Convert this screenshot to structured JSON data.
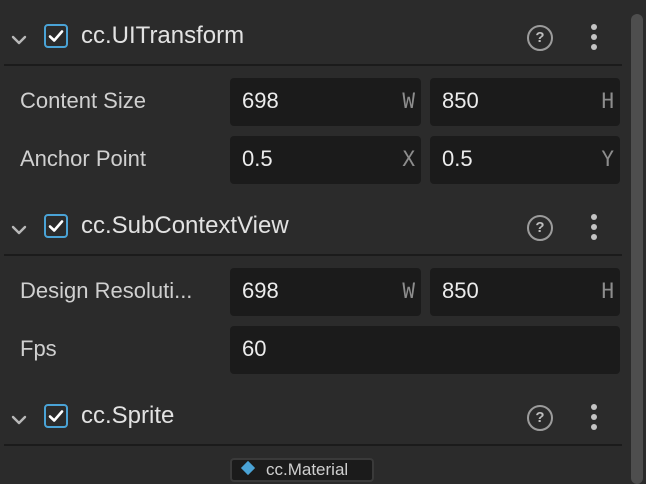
{
  "components": [
    {
      "title": "cc.UITransform",
      "checked": true,
      "rows": [
        {
          "label": "Content Size",
          "fields": [
            {
              "value": "698",
              "unit": "W"
            },
            {
              "value": "850",
              "unit": "H"
            }
          ]
        },
        {
          "label": "Anchor Point",
          "fields": [
            {
              "value": "0.5",
              "unit": "X"
            },
            {
              "value": "0.5",
              "unit": "Y"
            }
          ]
        }
      ]
    },
    {
      "title": "cc.SubContextView",
      "checked": true,
      "rows": [
        {
          "label": "Design Resoluti...",
          "fields": [
            {
              "value": "698",
              "unit": "W"
            },
            {
              "value": "850",
              "unit": "H"
            }
          ]
        },
        {
          "label": "Fps",
          "fields": [
            {
              "value": "60",
              "unit": ""
            }
          ]
        }
      ]
    },
    {
      "title": "cc.Sprite",
      "checked": true,
      "rows": []
    }
  ],
  "help_glyph": "?",
  "material_chip": {
    "label": "cc.Material",
    "icon": "material-diamond-icon"
  },
  "colors": {
    "accent": "#4aa3d6",
    "background": "#2b2b2b",
    "field": "#1b1b1b"
  }
}
